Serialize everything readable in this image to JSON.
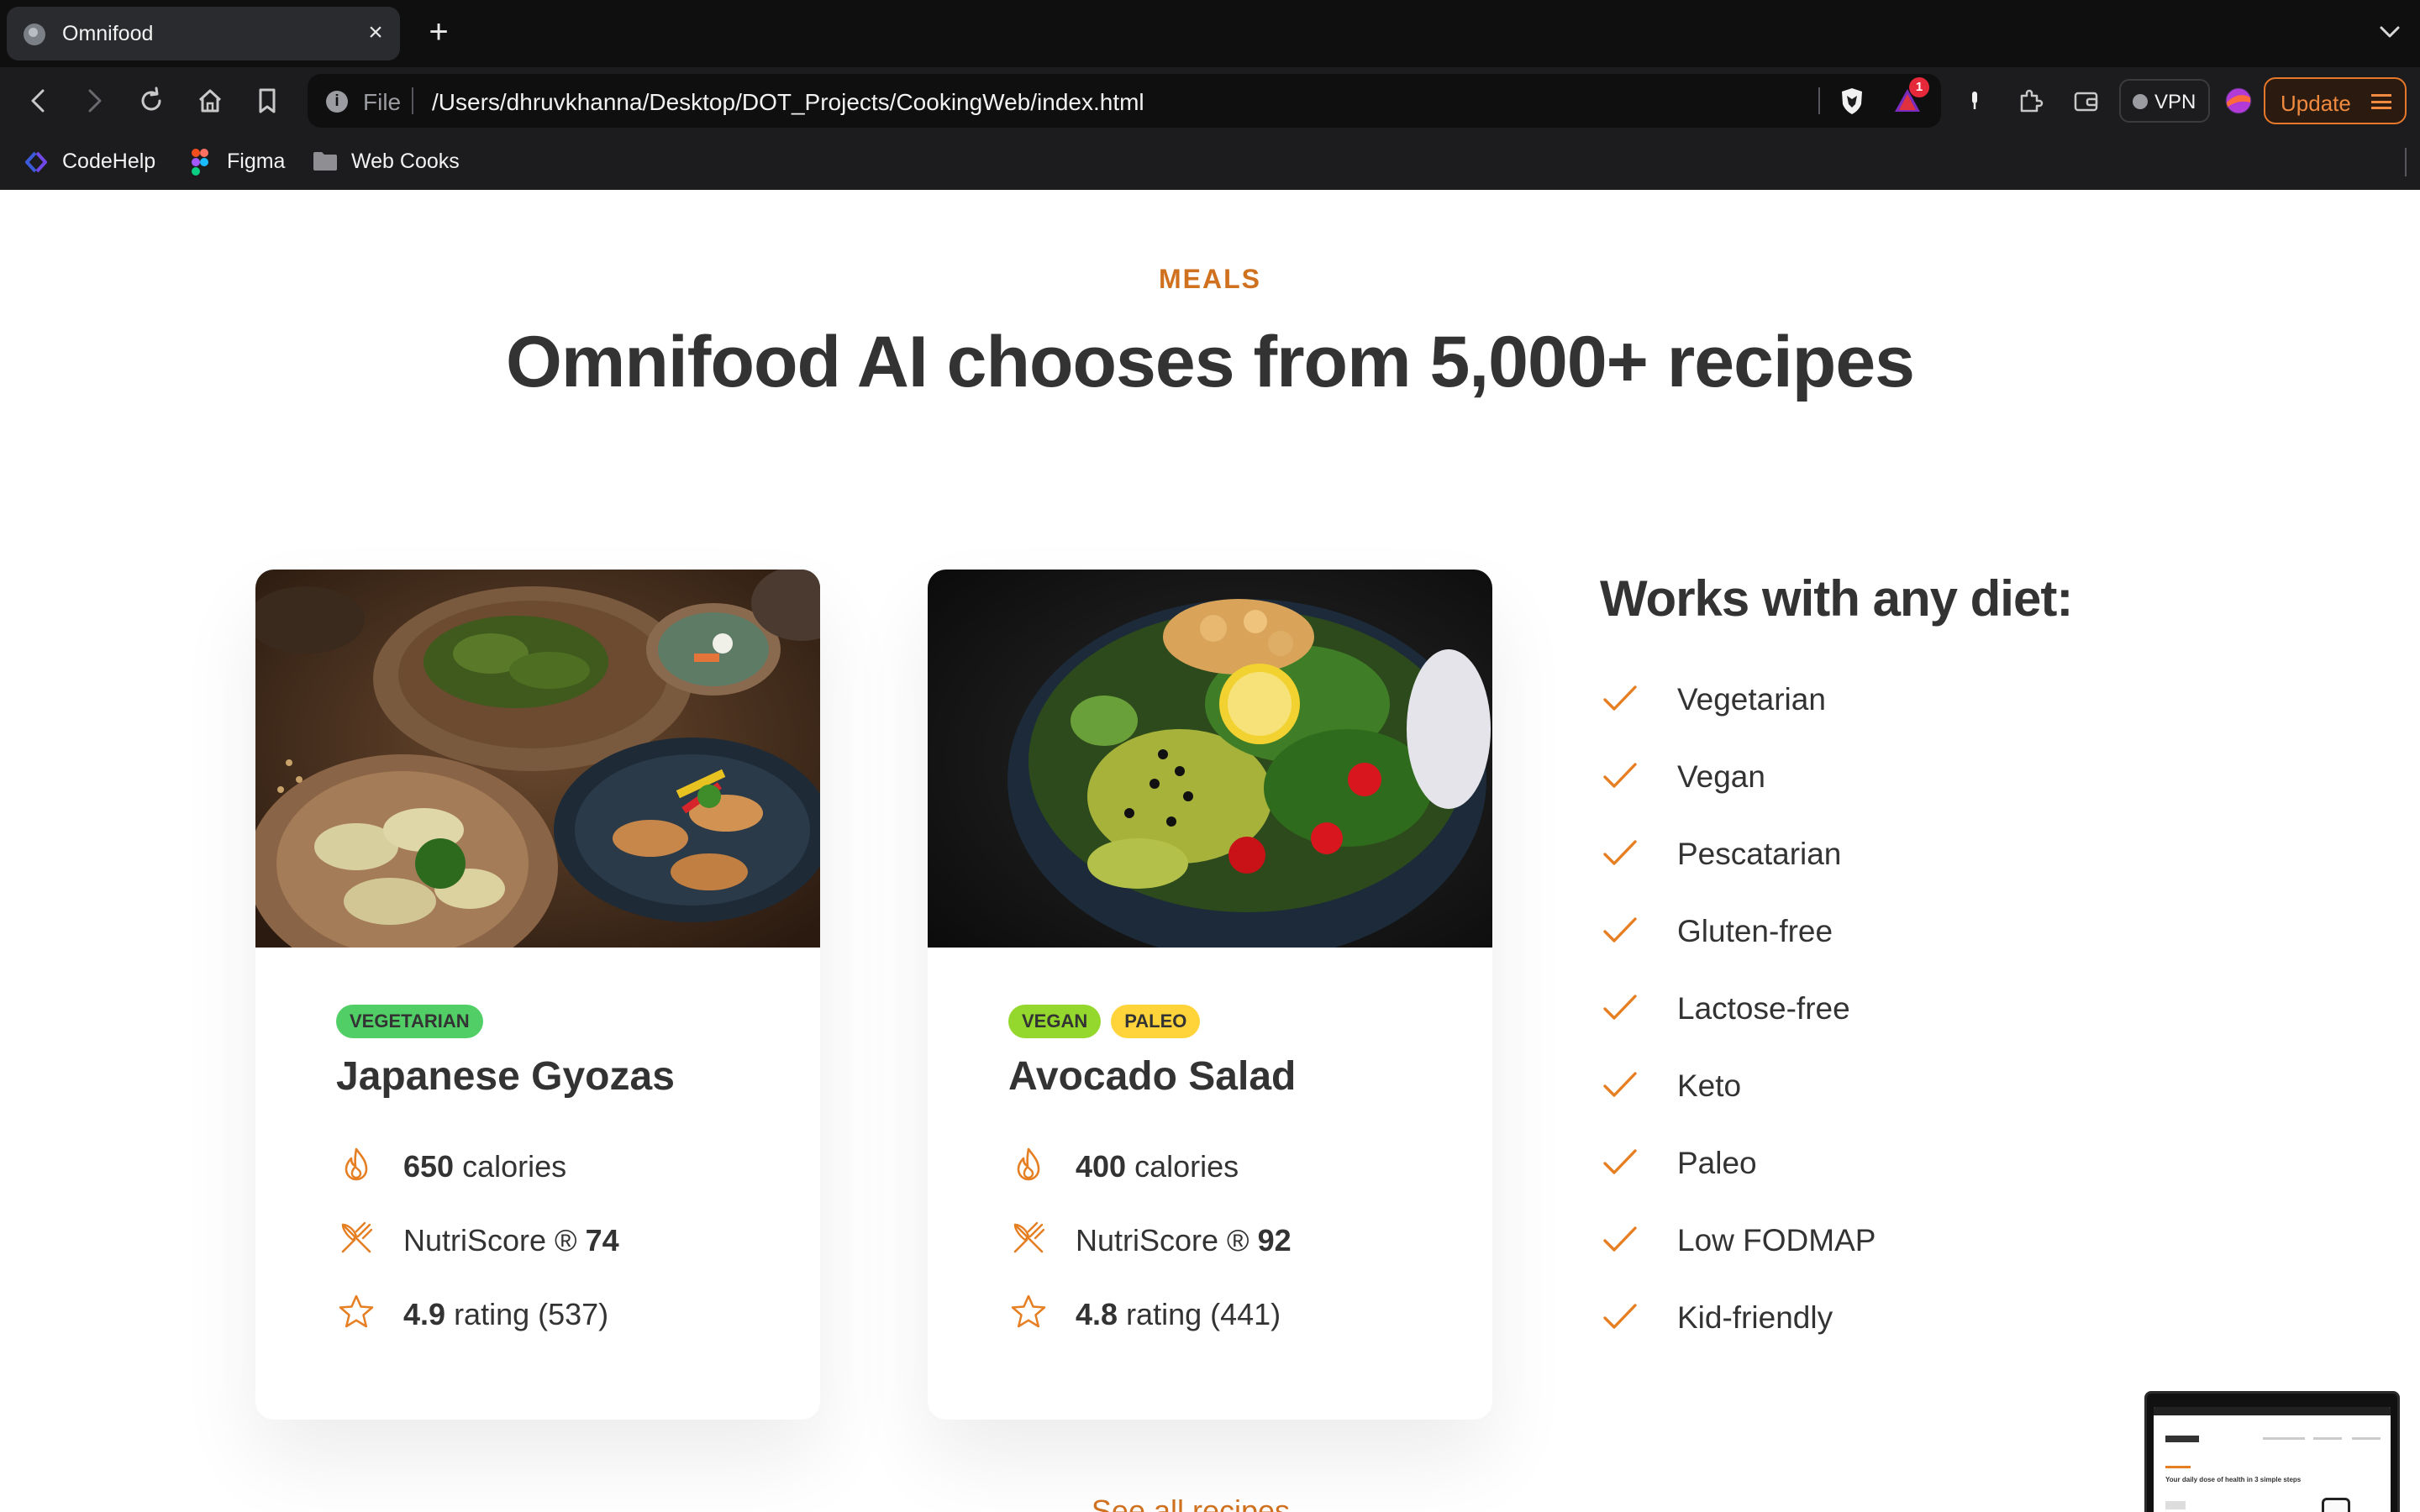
{
  "browser": {
    "tab_title": "Omnifood",
    "url_scheme": "File",
    "url": "/Users/dhruvkhanna/Desktop/DOT_Projects/CookingWeb/index.html",
    "notification_count": "1",
    "vpn_label": "VPN",
    "update_label": "Update",
    "bookmarks": [
      {
        "label": "CodeHelp",
        "icon": "codehelp-icon"
      },
      {
        "label": "Figma",
        "icon": "figma-icon"
      },
      {
        "label": "Web Cooks",
        "icon": "folder-icon"
      }
    ]
  },
  "section": {
    "subheading": "MEALS",
    "heading": "Omnifood AI chooses from 5,000+ recipes"
  },
  "meals": [
    {
      "image": "japanese-gyozas-photo",
      "tags": [
        "VEGETARIAN"
      ],
      "title": "Japanese Gyozas",
      "calories_value": "650",
      "calories_unit": "calories",
      "nutriscore_label": "NutriScore ®",
      "nutriscore_value": "74",
      "rating_value": "4.9",
      "rating_suffix": "rating (537)"
    },
    {
      "image": "avocado-salad-photo",
      "tags": [
        "VEGAN",
        "PALEO"
      ],
      "title": "Avocado Salad",
      "calories_value": "400",
      "calories_unit": "calories",
      "nutriscore_label": "NutriScore ®",
      "nutriscore_value": "92",
      "rating_value": "4.8",
      "rating_suffix": "rating (441)"
    }
  ],
  "diets": {
    "title": "Works with any diet:",
    "items": [
      "Vegetarian",
      "Vegan",
      "Pescatarian",
      "Gluten-free",
      "Lactose-free",
      "Keto",
      "Paleo",
      "Low FODMAP",
      "Kid-friendly"
    ]
  },
  "see_all_link": "See all recipes →",
  "pip_preview": {
    "title": "Your daily dose of health in 3 simple steps"
  },
  "colors": {
    "accent": "#e67e22",
    "accent_dark": "#cf711f",
    "text": "#333333",
    "tag_vegetarian": "#51cf66",
    "tag_vegan": "#94d82d",
    "tag_paleo": "#ffd43b"
  }
}
